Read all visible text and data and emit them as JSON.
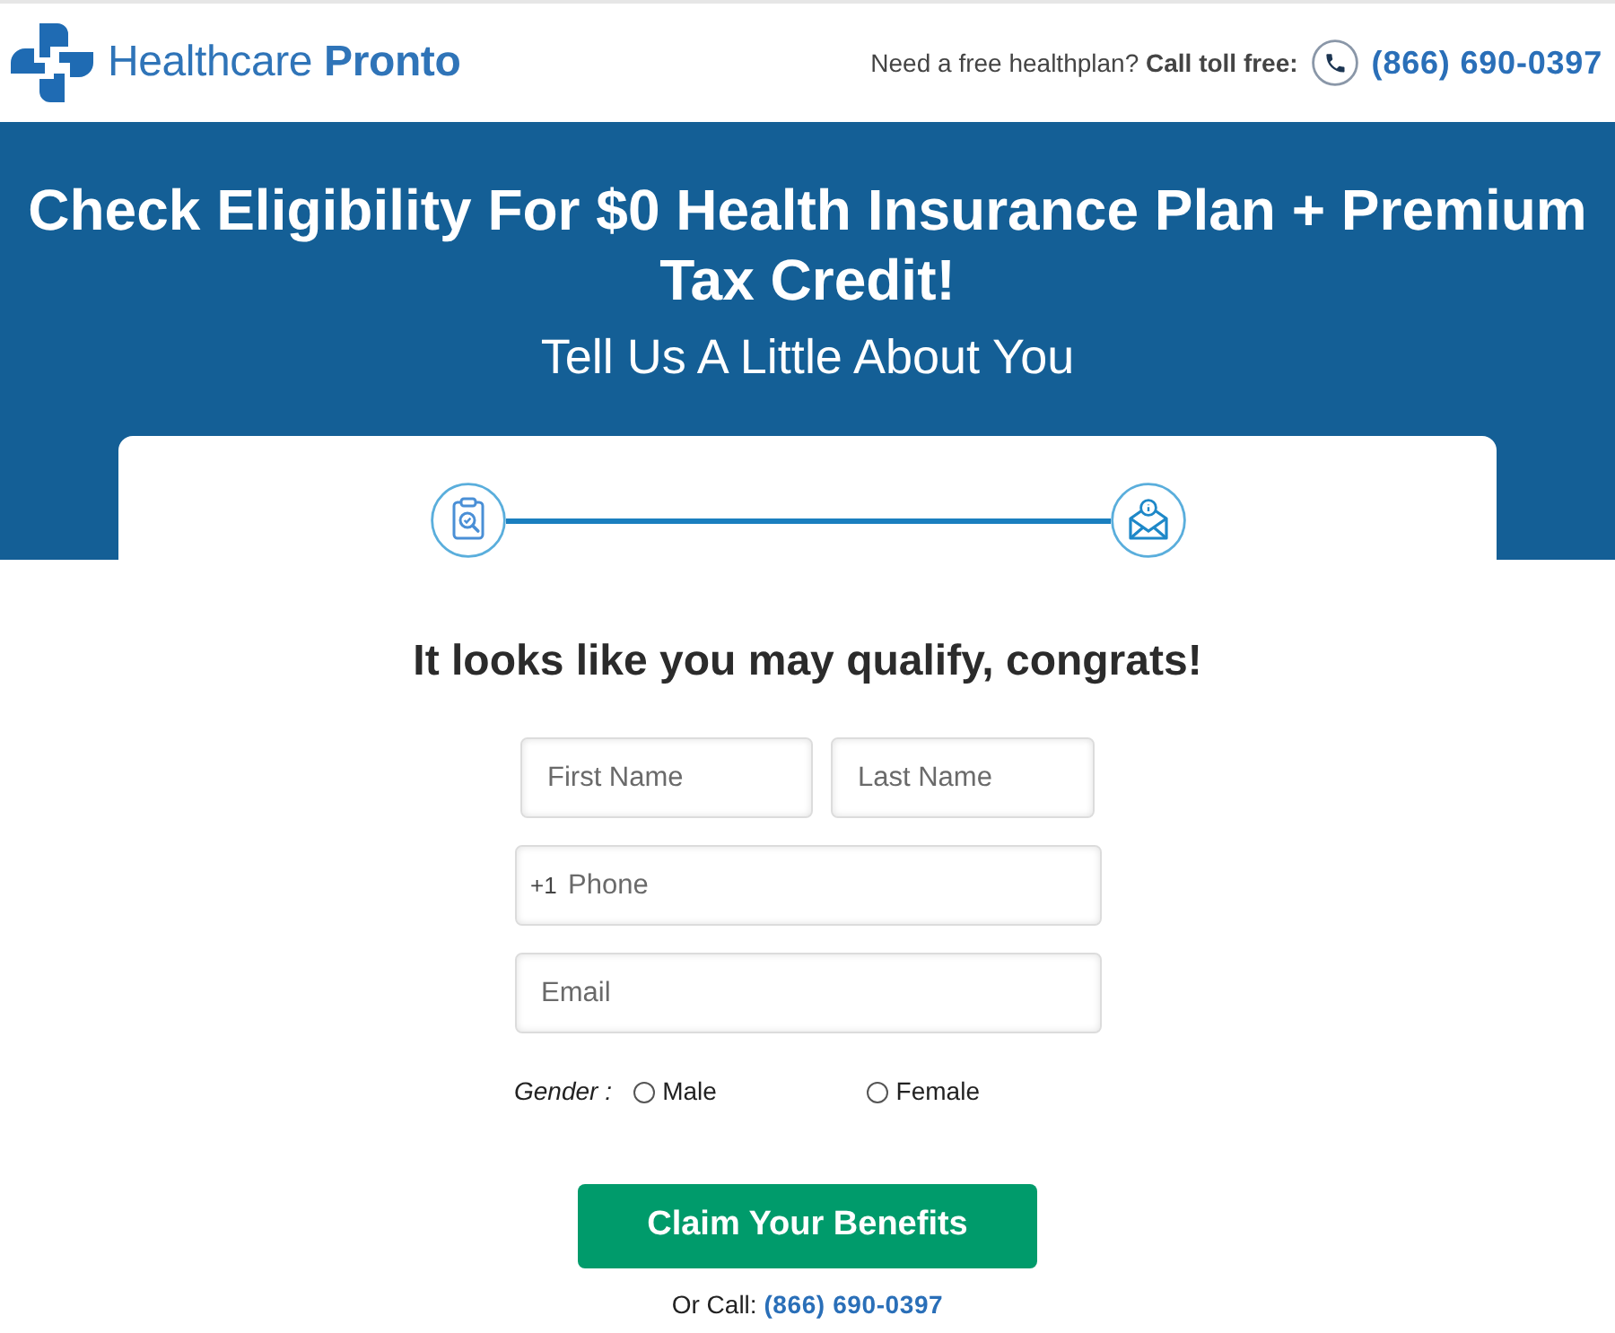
{
  "header": {
    "logo_text": "Healthcare **Pronto**",
    "prompt": "Need a free healthplan? **Call toll free:**",
    "phone": "(866) 690-0397"
  },
  "hero": {
    "title": "Check Eligibility For $0 Health Insurance Plan + Premium Tax Credit!",
    "subtitle": "Tell Us A Little About You"
  },
  "form": {
    "heading": "It looks like you may qualify, congrats!",
    "field_rows": [
      [
        {
          "placeholder": "First Name"
        },
        {
          "placeholder": "Last Name"
        }
      ],
      [
        {
          "prefix": "+1",
          "placeholder": "Phone"
        }
      ],
      [
        {
          "placeholder": "Email"
        }
      ]
    ],
    "gender": {
      "label": "Gender :",
      "options": [
        {
          "label": "Male",
          "selected": false
        },
        {
          "label": "Female",
          "selected": false
        }
      ]
    },
    "submit": "Claim Your Benefits",
    "call": "Or Call:",
    "call_phone": "(866) 690-0397"
  }
}
